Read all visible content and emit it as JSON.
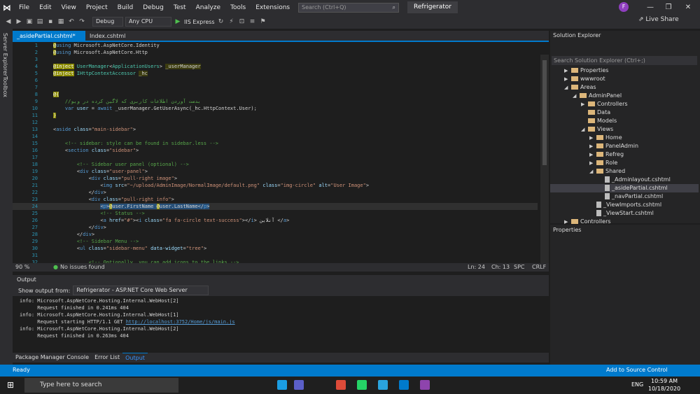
{
  "menu": [
    "File",
    "Edit",
    "View",
    "Project",
    "Build",
    "Debug",
    "Test",
    "Analyze",
    "Tools",
    "Extensions",
    "Window",
    "Help"
  ],
  "search": {
    "placeholder": "Search (Ctrl+Q)"
  },
  "project_name": "Refrigerator",
  "user_initial": "F",
  "toolbar": {
    "config": "Debug",
    "platform": "Any CPU",
    "run": "IIS Express",
    "liveshare": "Live Share"
  },
  "side": {
    "server_explorer": "Server Explorer",
    "toolbox": "Toolbox"
  },
  "tabs": [
    {
      "label": "_asidePartial.cshtml*"
    },
    {
      "label": "Index.cshtml"
    }
  ],
  "code_lines": [
    {
      "n": "1",
      "html": "<span class='dir'>@</span><span class='k'>using</span> Microsoft.AspNetCore.Identity"
    },
    {
      "n": "2",
      "html": "<span class='dir'>@</span><span class='k'>using</span> Microsoft.AspNetCore.Http"
    },
    {
      "n": "3",
      "html": ""
    },
    {
      "n": "4",
      "html": "<span class='dir'>@inject</span> <span class='t'>UserManager</span>&lt;<span class='t'>ApplicationUsers</span>&gt; <span class='raz'>_userManager</span>"
    },
    {
      "n": "5",
      "html": "<span class='dir'>@inject</span> <span class='t'>IHttpContextAccessor</span> <span class='raz'>_hc</span>"
    },
    {
      "n": "6",
      "html": ""
    },
    {
      "n": "7",
      "html": ""
    },
    {
      "n": "8",
      "html": "<span class='dir'>@{</span>"
    },
    {
      "n": "9",
      "html": "    <span class='c'>//بدست آوردن اطلاعات کاربری که لاگین کرده در ویو</span>"
    },
    {
      "n": "10",
      "html": "    <span class='k'>var</span> <span class='a'>user</span> = <span class='k'>await</span> _userManager.GetUserAsync(_hc.HttpContext.User);"
    },
    {
      "n": "11",
      "html": "<span class='dir'>}</span>"
    },
    {
      "n": "12",
      "html": ""
    },
    {
      "n": "13",
      "html": "&lt;<span class='k'>aside</span> <span class='a'>class</span>=<span class='s'>\"main-sidebar\"</span>&gt;"
    },
    {
      "n": "14",
      "html": ""
    },
    {
      "n": "15",
      "html": "    <span class='c'>&lt;!-- sidebar: style can be found in sidebar.less --&gt;</span>"
    },
    {
      "n": "16",
      "html": "    &lt;<span class='k'>section</span> <span class='a'>class</span>=<span class='s'>\"sidebar\"</span>&gt;"
    },
    {
      "n": "17",
      "html": ""
    },
    {
      "n": "18",
      "html": "        <span class='c'>&lt;!-- Sidebar user panel (optional) --&gt;</span>"
    },
    {
      "n": "19",
      "html": "        &lt;<span class='k'>div</span> <span class='a'>class</span>=<span class='s'>\"user-panel\"</span>&gt;"
    },
    {
      "n": "20",
      "html": "            &lt;<span class='k'>div</span> <span class='a'>class</span>=<span class='s'>\"pull-right image\"</span>&gt;"
    },
    {
      "n": "21",
      "html": "                &lt;<span class='k'>img</span> <span class='a'>src</span>=<span class='s'>\"~/upload/AdminImage/NormalImage/default.png\"</span> <span class='a'>class</span>=<span class='s'>\"img-circle\"</span> <span class='a'>alt</span>=<span class='s'>\"User Image\"</span>&gt;"
    },
    {
      "n": "22",
      "html": "            &lt;/<span class='k'>div</span>&gt;"
    },
    {
      "n": "23",
      "html": "            &lt;<span class='k'>div</span> <span class='a'>class</span>=<span class='s'>\"pull-right info\"</span>&gt;"
    },
    {
      "n": "24",
      "html": "                <span class='hl'>&lt;<span class='k'>p</span>&gt;<span class='dir'>@</span>user.FirstName <span class='dir'>@</span>user.LastName&lt;/<span class='k'>p</span>&gt;</span>"
    },
    {
      "n": "25",
      "html": "                <span class='c'>&lt;!-- Status --&gt;</span>"
    },
    {
      "n": "26",
      "html": "                &lt;<span class='k'>a</span> <span class='a'>href</span>=<span class='s'>\"#\"</span>&gt;&lt;<span class='k'>i</span> <span class='a'>class</span>=<span class='s'>\"fa fa-circle text-success\"</span>&gt;&lt;/<span class='k'>i</span>&gt; آنلاین &lt;/<span class='k'>a</span>&gt;"
    },
    {
      "n": "27",
      "html": "            &lt;/<span class='k'>div</span>&gt;"
    },
    {
      "n": "28",
      "html": "        &lt;/<span class='k'>div</span>&gt;"
    },
    {
      "n": "29",
      "html": "        <span class='c'>&lt;!-- Sidebar Menu --&gt;</span>"
    },
    {
      "n": "30",
      "html": "        &lt;<span class='k'>ul</span> <span class='a'>class</span>=<span class='s'>\"sidebar-menu\"</span> <span class='a'>data-widget</span>=<span class='s'>\"tree\"</span>&gt;"
    },
    {
      "n": "31",
      "html": ""
    },
    {
      "n": "32",
      "html": "            <span class='c'>&lt;!-- Optionally, you can add icons to the links --&gt;</span>"
    }
  ],
  "editor_status": {
    "zoom": "90 %",
    "issues": "No issues found",
    "ln": "Ln: 24",
    "ch": "Ch: 13",
    "spc": "SPC",
    "crlf": "CRLF"
  },
  "output": {
    "title": "Output",
    "show_from": "Show output from:",
    "source": "Refrigerator - ASP.NET Core Web Server",
    "lines": [
      "info: Microsoft.AspNetCore.Hosting.Internal.WebHost[2]",
      "      Request finished in 0.241ms 404",
      "info: Microsoft.AspNetCore.Hosting.Internal.WebHost[1]",
      "      Request starting HTTP/1.1 GET ",
      "info: Microsoft.AspNetCore.Hosting.Internal.WebHost[2]",
      "      Request finished in 0.263ms 404"
    ],
    "link": "http://localhost:3752/Home/js/main.js"
  },
  "bottom_tabs": [
    "Package Manager Console",
    "Error List",
    "Output"
  ],
  "solution_explorer": {
    "title": "Solution Explorer",
    "search_placeholder": "Search Solution Explorer (Ctrl+;)",
    "nodes": [
      {
        "label": "Properties",
        "depth": 1,
        "kind": "folder",
        "arrow": "▶"
      },
      {
        "label": "wwwroot",
        "depth": 1,
        "kind": "folder",
        "arrow": "▶"
      },
      {
        "label": "Areas",
        "depth": 1,
        "kind": "folder",
        "arrow": "◢"
      },
      {
        "label": "AdminPanel",
        "depth": 2,
        "kind": "folder",
        "arrow": "◢"
      },
      {
        "label": "Controllers",
        "depth": 3,
        "kind": "folder",
        "arrow": "▶"
      },
      {
        "label": "Data",
        "depth": 3,
        "kind": "folder",
        "arrow": ""
      },
      {
        "label": "Models",
        "depth": 3,
        "kind": "folder",
        "arrow": ""
      },
      {
        "label": "Views",
        "depth": 3,
        "kind": "folder",
        "arrow": "◢"
      },
      {
        "label": "Home",
        "depth": 4,
        "kind": "folder",
        "arrow": "▶"
      },
      {
        "label": "PanelAdmin",
        "depth": 4,
        "kind": "folder",
        "arrow": "▶"
      },
      {
        "label": "Refreg",
        "depth": 4,
        "kind": "folder",
        "arrow": "▶"
      },
      {
        "label": "Role",
        "depth": 4,
        "kind": "folder",
        "arrow": "▶"
      },
      {
        "label": "Shared",
        "depth": 4,
        "kind": "folder",
        "arrow": "◢"
      },
      {
        "label": "_Adminlayout.cshtml",
        "depth": 5,
        "kind": "file",
        "arrow": ""
      },
      {
        "label": "_asidePartial.cshtml",
        "depth": 5,
        "kind": "file",
        "arrow": "",
        "selected": true
      },
      {
        "label": "_navPartial.cshtml",
        "depth": 5,
        "kind": "file",
        "arrow": ""
      },
      {
        "label": "_ViewImports.cshtml",
        "depth": 4,
        "kind": "file",
        "arrow": ""
      },
      {
        "label": "_ViewStart.cshtml",
        "depth": 4,
        "kind": "file",
        "arrow": ""
      },
      {
        "label": "Controllers",
        "depth": 1,
        "kind": "folder",
        "arrow": "▶"
      }
    ]
  },
  "properties": {
    "title": "Properties"
  },
  "vs_status": {
    "ready": "Ready",
    "source_control": "Add to Source Control"
  },
  "taskbar": {
    "search": "Type here to search",
    "lang": "ENG",
    "time": "10:59 AM",
    "date": "10/18/2020"
  }
}
